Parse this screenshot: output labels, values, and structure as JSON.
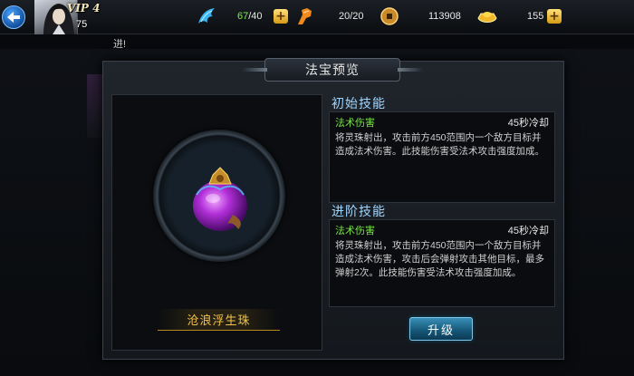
{
  "hud": {
    "vip_label": "VIP 4",
    "player_level": "75",
    "stamina": {
      "current": "67",
      "max": "/40",
      "icon": "stamina-wing-icon"
    },
    "energy": {
      "current": "20/20",
      "icon": "energy-fist-icon"
    },
    "coins": {
      "value": "113908",
      "icon": "coin-icon"
    },
    "ingots": {
      "value": "155",
      "icon": "gold-ingot-icon"
    },
    "plus_symbol": "+"
  },
  "background": {
    "label": "进!"
  },
  "modal": {
    "title": "法宝预览",
    "treasure_name": "沧浪浮生珠",
    "initial_skill": {
      "section_title": "初始技能",
      "name": "法术伤害",
      "cooldown": "45秒冷却",
      "description": "将灵珠射出，攻击前方450范围内一个敌方目标并造成法术伤害。此技能伤害受法术攻击强度加成。"
    },
    "advanced_skill": {
      "section_title": "进阶技能",
      "name": "法术伤害",
      "cooldown": "45秒冷却",
      "description": "将灵珠射出，攻击前方450范围内一个敌方目标并造成法术伤害，攻击后会弹射攻击其他目标，最多弹射2次。此技能伤害受法术攻击强度加成。"
    },
    "upgrade_label": "升级"
  },
  "colors": {
    "skill_name": "#7be24b",
    "section_title": "#9fd6ff",
    "treasure_name": "#f2c34b",
    "stamina_current": "#7bea54"
  }
}
